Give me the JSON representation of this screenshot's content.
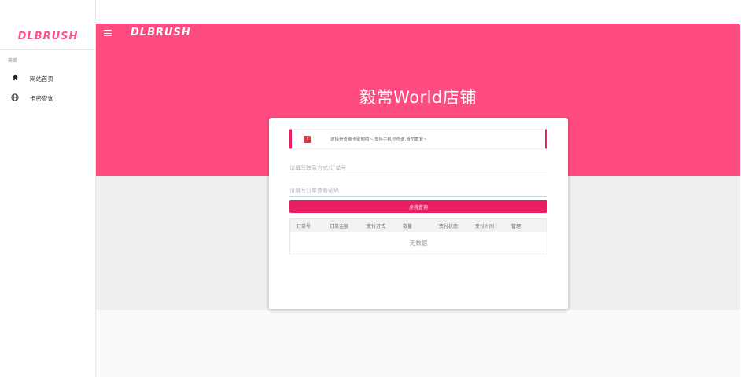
{
  "brand": {
    "logo": "DLBRUSH",
    "accent": "#ff4c80",
    "button": "#e91e63"
  },
  "sidebar": {
    "section_label": "菜单",
    "items": [
      {
        "label": "网站首页",
        "icon": "home-icon"
      },
      {
        "label": "卡密查询",
        "icon": "globe-icon"
      }
    ]
  },
  "header": {
    "logo": "DLBRUSH",
    "title": "毅常World店铺"
  },
  "card": {
    "notice": "这接是查询卡密的哦~,支持手机号查询,请勿重复~",
    "contact_placeholder": "请填写联系方式/订单号",
    "password_placeholder": "请填写订单查看密码",
    "submit_label": "点我查询",
    "table": {
      "columns": [
        "订单号",
        "订单金额",
        "支付方式",
        "数量",
        "支付状态",
        "支付时间",
        "管理"
      ],
      "empty_text": "无数据"
    }
  }
}
